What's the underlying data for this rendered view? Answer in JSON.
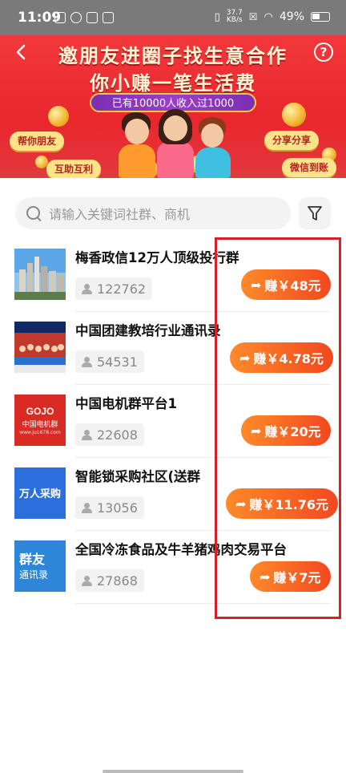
{
  "status_bar": {
    "time": "11:09",
    "speed_value": "37.7",
    "speed_unit": "KB/s",
    "battery": "49%"
  },
  "banner": {
    "title": "邀朋友进圈子找生意合作",
    "subtitle": "你小赚一笔生活费",
    "ribbon": "已有10000人收入过1000",
    "pills": [
      "帮你朋友",
      "互助互利",
      "分享分享",
      "微信到账"
    ]
  },
  "search": {
    "placeholder": "请输入关键词社群、商机"
  },
  "groups": [
    {
      "name": "梅香政信12万人顶级投行群",
      "members": "122762",
      "reward": "赚￥48元"
    },
    {
      "name": "中国团建教培行业通讯录",
      "members": "54531",
      "reward": "赚￥4.78元"
    },
    {
      "name": "中国电机群平台1",
      "members": "22608",
      "reward": "赚￥20元"
    },
    {
      "name": "智能锁采购社区(送群",
      "members": "13056",
      "reward": "赚￥11.76元"
    },
    {
      "name": "全国冷冻食品及牛羊猪鸡肉交易平台",
      "members": "27868",
      "reward": "赚￥7元"
    }
  ],
  "thumb_texts": {
    "gojo_brand": "GOJO",
    "gojo_cn": "中国电机群",
    "gojo_url": "www.ju1678.com",
    "wanren": "万人采购",
    "qunyou_1": "群友",
    "qunyou_2": "通讯录"
  }
}
